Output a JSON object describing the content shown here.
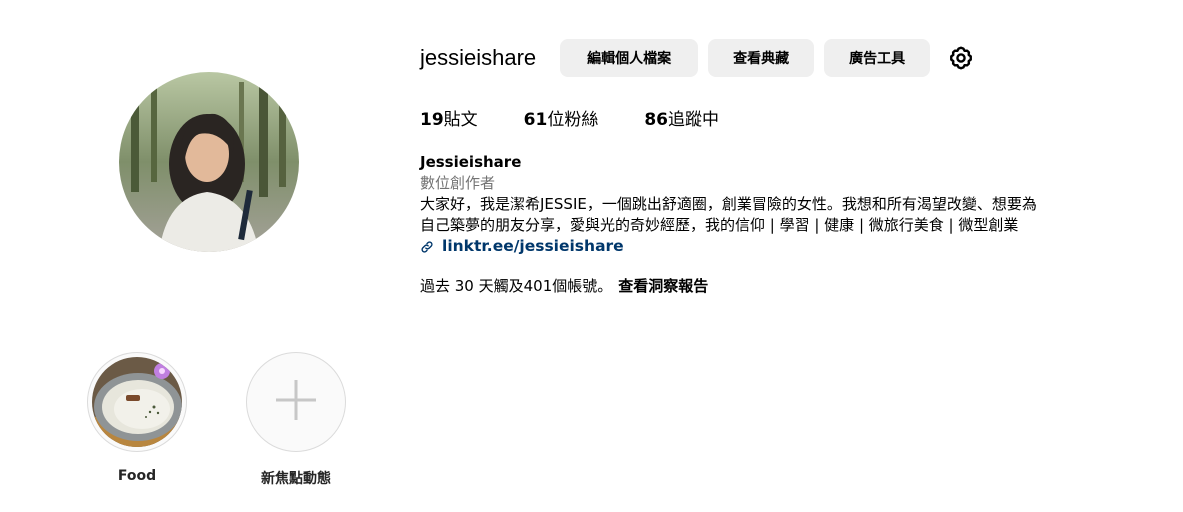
{
  "profile": {
    "username": "jessieishare",
    "avatar_icon": "profile-photo"
  },
  "header": {
    "edit_profile_label": "編輯個人檔案",
    "view_archive_label": "查看典藏",
    "ad_tools_label": "廣告工具",
    "settings_icon": "gear-icon"
  },
  "stats": {
    "posts_count": "19",
    "posts_label": "貼文",
    "followers_count": "61",
    "followers_label": "位粉絲",
    "following_count": "86",
    "following_label": "追蹤中"
  },
  "bio": {
    "name": "Jessieishare",
    "category": "數位創作者",
    "text": "大家好，我是潔希JESSIE，一個跳出舒適圈，創業冒險的女性。我想和所有渴望改變、想要為\n自己築夢的朋友分享，愛與光的奇妙經歷，我的信仰 | 學習 | 健康 | 微旅行美食 | 微型創業",
    "link": "linktr.ee/jessieishare",
    "link_icon": "link-icon"
  },
  "reach": {
    "text": "過去 30 天觸及401個帳號。",
    "insights_label": "查看洞察報告"
  },
  "highlights": [
    {
      "label": "Food",
      "icon": "food-thumbnail"
    },
    {
      "label": "新焦點動態",
      "icon": "plus-icon"
    }
  ],
  "colors": {
    "button_bg": "#efefef",
    "link": "#00376b",
    "secondary_text": "#737373"
  }
}
